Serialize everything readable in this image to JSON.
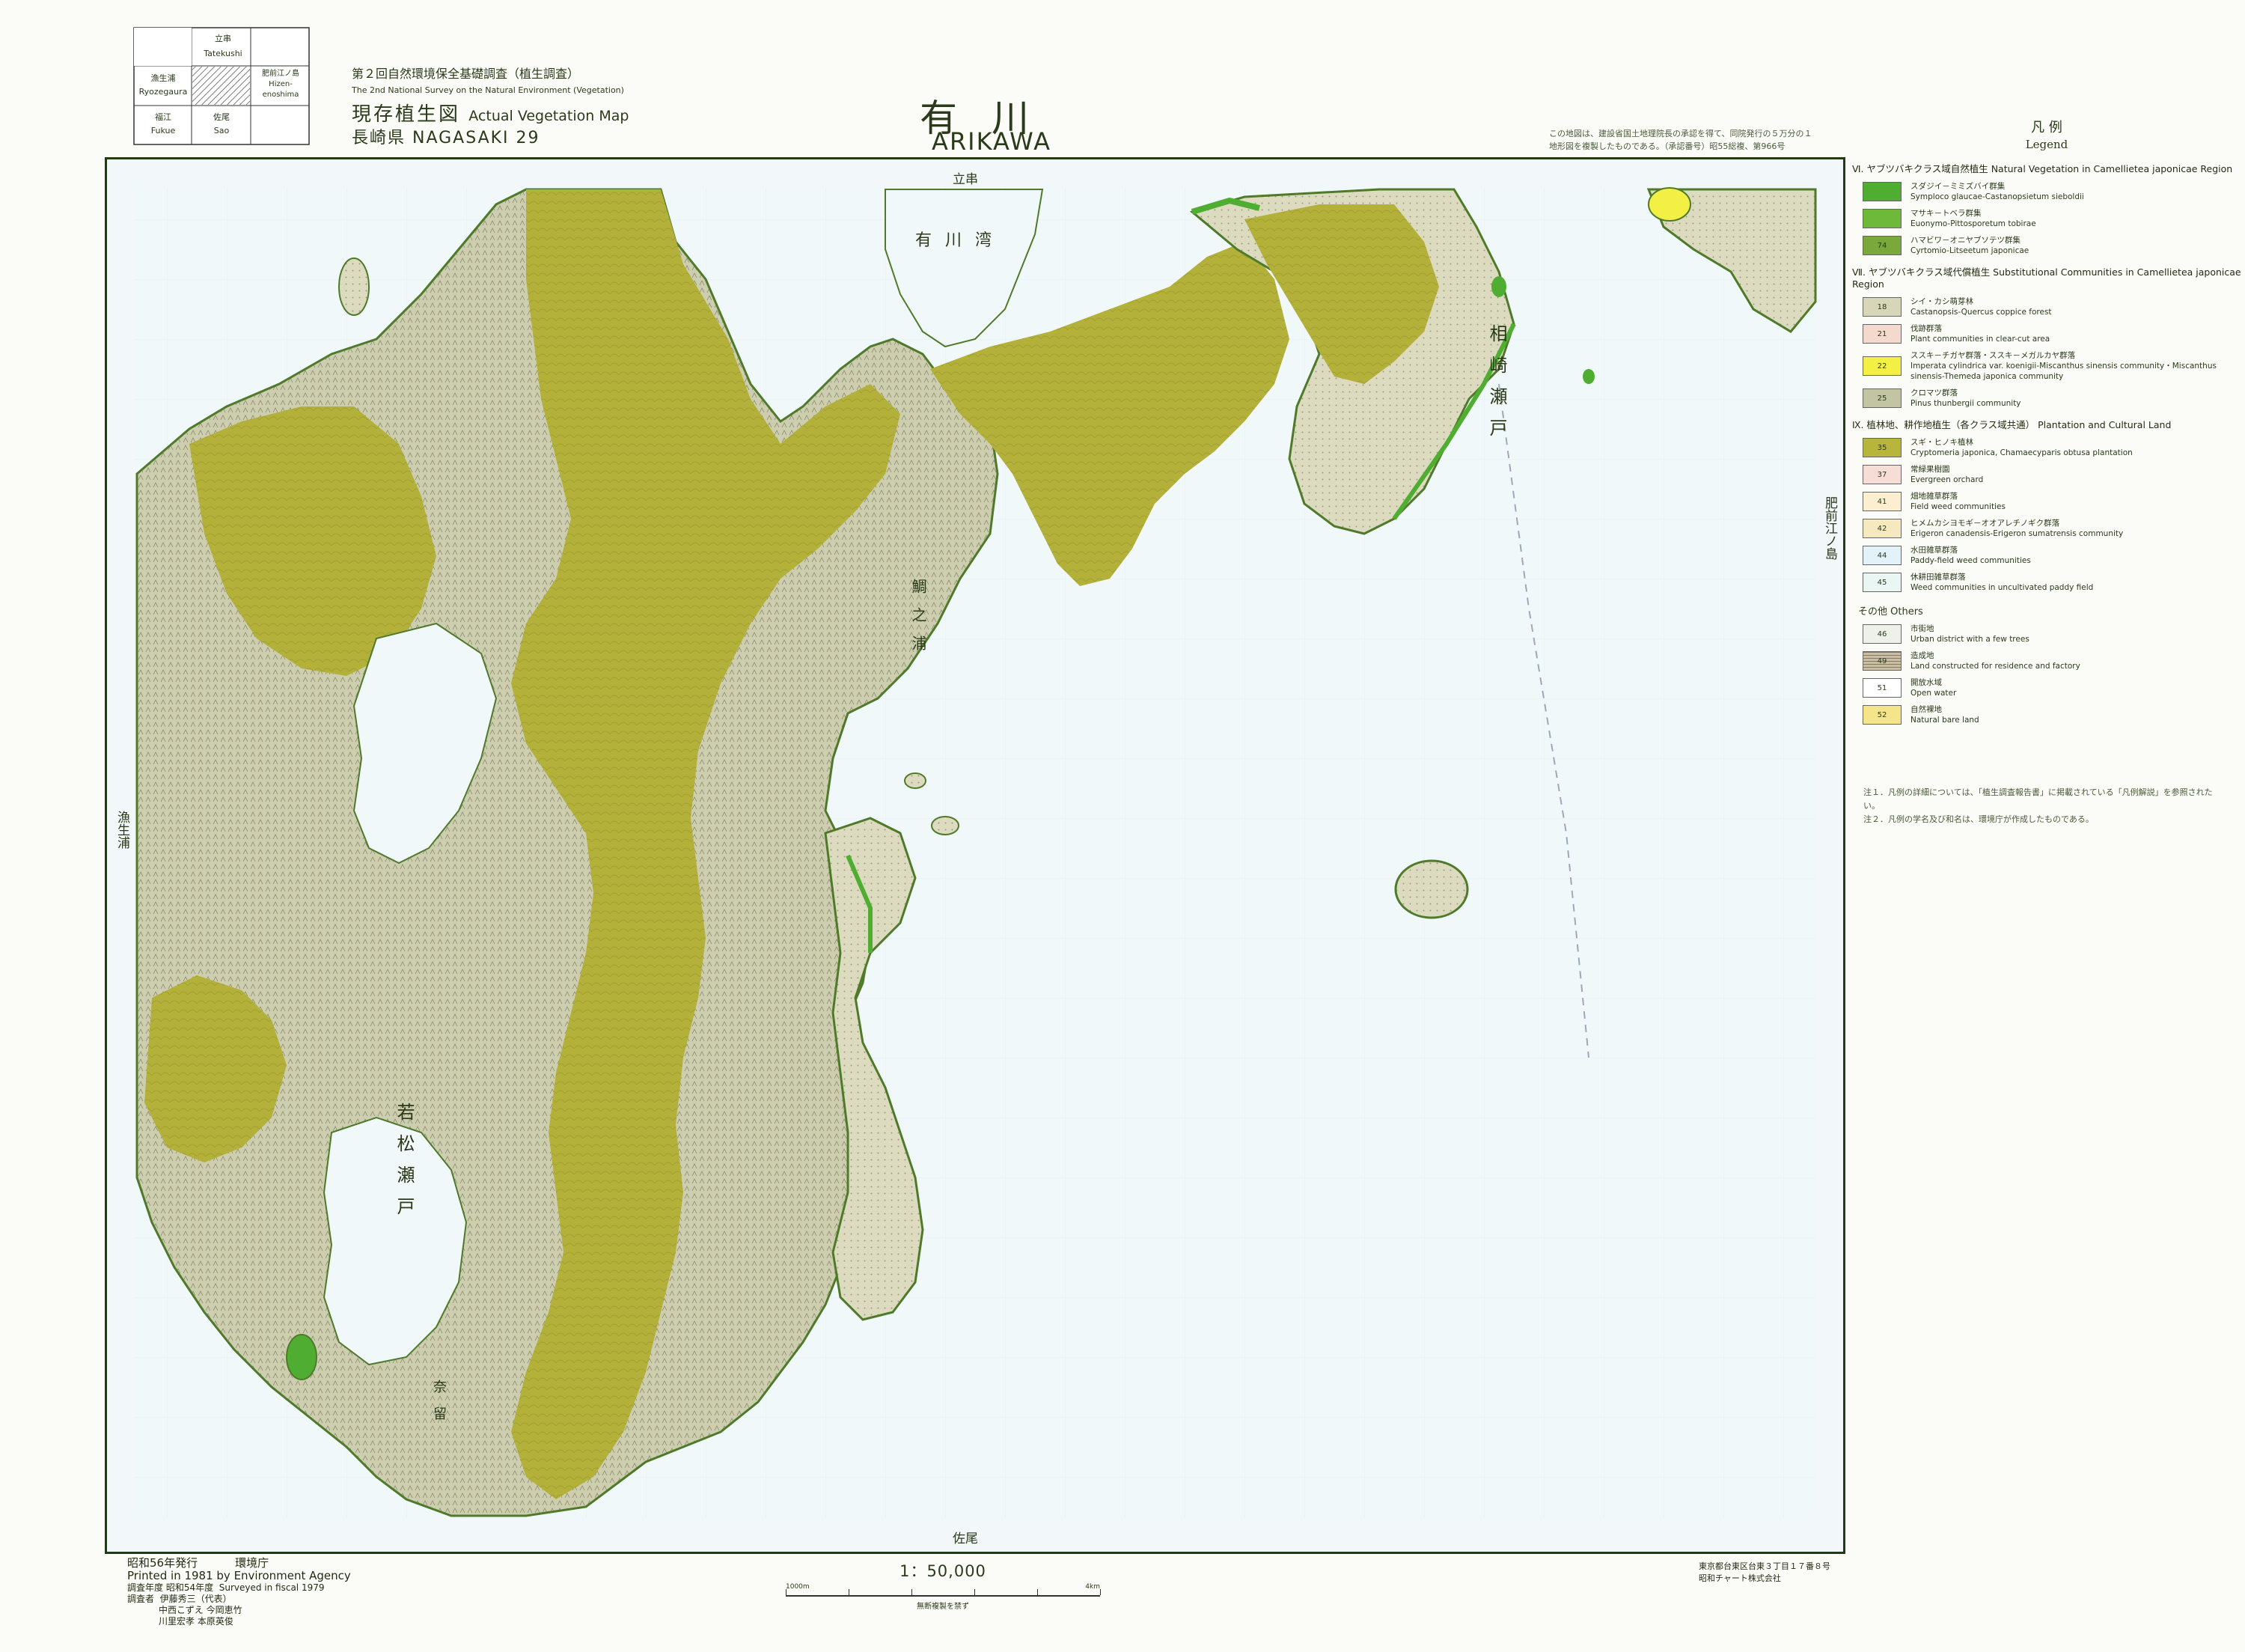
{
  "index_diagram": {
    "cells": [
      {
        "jp": "立串",
        "en": "Tatekushi"
      },
      {
        "jp": "肥前江ノ島",
        "en": "Hizen-enoshima"
      },
      {
        "jp": "漁生浦",
        "en": "Ryozegaura"
      },
      {
        "jp": "福江",
        "en": "Fukue"
      },
      {
        "jp": "佐尾",
        "en": "Sao"
      }
    ]
  },
  "header": {
    "series_jp": "第２回自然環境保全基礎調査（植生調査）",
    "series_en": "The 2nd National Survey on the Natural Environment (Vegetation)",
    "map_type_jp": "現存植生図",
    "map_type_en": "Actual Vegetation Map",
    "prefecture": "長崎県 NAGASAKI 29",
    "title_jp": "有川",
    "title_en": "ARIKAWA",
    "top_note": "この地図は、建設省国土地理院長の承認を得て、同院発行の５万分の１地形図を複製したものである。（承認番号）昭55総複、第966号"
  },
  "map": {
    "top_label": "立串",
    "bottom_label": "佐尾",
    "left_label": "漁生浦",
    "right_label": "肥前江ノ島",
    "places": {
      "arikawa_bay": "有川湾",
      "aizaki_strait": "相崎瀬戸",
      "wakamatsu_strait": "若松瀬戸",
      "tainoura": "鯛之浦",
      "naru": "奈留"
    }
  },
  "legend": {
    "title_jp": "凡 例",
    "title_en": "Legend",
    "sections": [
      {
        "heading": "Ⅵ. ヤブツバキクラス域自然植生 Natural Vegetation in Camellietea japonicae Region",
        "items": [
          {
            "code": "",
            "color": "#4fae32",
            "jp": "スダジイ－ミミズバイ群集",
            "en": "Symploco glaucae-Castanopsietum sieboldii"
          },
          {
            "code": "",
            "color": "#6fb93a",
            "jp": "マサキ－トベラ群集",
            "en": "Euonymo-Pittosporetum tobirae"
          },
          {
            "code": "74",
            "color": "#7aa83a",
            "jp": "ハマビワ－オニヤブソテツ群集",
            "en": "Cyrtomio-Litseetum japonicae"
          }
        ]
      },
      {
        "heading": "Ⅶ. ヤブツバキクラス域代償植生 Substitutional Communities in Camellietea japonicae Region",
        "items": [
          {
            "code": "18",
            "color": "#d7d6b8",
            "jp": "シイ・カシ萌芽林",
            "en": "Castanopsis-Quercus coppice forest"
          },
          {
            "code": "21",
            "color": "#f4d9cf",
            "jp": "伐跡群落",
            "en": "Plant communities in clear-cut area"
          },
          {
            "code": "22",
            "color": "#f3ef45",
            "jp": "ススキ－チガヤ群落・ススキ－メガルカヤ群落",
            "en": "Imperata cylindrica var. koenigii-Miscanthus sinensis community・Miscanthus sinensis-Themeda japonica community"
          },
          {
            "code": "25",
            "color": "#c2c4a4",
            "jp": "クロマツ群落",
            "en": "Pinus thunbergii community"
          }
        ]
      },
      {
        "heading": "Ⅸ. 植林地、耕作地植生（各クラス域共通） Plantation and Cultural Land",
        "items": [
          {
            "code": "35",
            "color": "#b7b63a",
            "jp": "スギ・ヒノキ植林",
            "en": "Cryptomeria japonica, Chamaecyparis obtusa plantation"
          },
          {
            "code": "37",
            "color": "#f6ddd6",
            "jp": "常緑果樹園",
            "en": "Evergreen orchard"
          },
          {
            "code": "41",
            "color": "#fbefcf",
            "jp": "畑地雑草群落",
            "en": "Field weed communities"
          },
          {
            "code": "42",
            "color": "#f7e9bf",
            "jp": "ヒメムカシヨモギ－オオアレチノギク群落",
            "en": "Erigeron canadensis-Erigeron sumatrensis community"
          },
          {
            "code": "44",
            "color": "#e3f2f9",
            "jp": "水田雑草群落",
            "en": "Paddy-field weed communities"
          },
          {
            "code": "45",
            "color": "#e9f6f4",
            "jp": "休耕田雑草群落",
            "en": "Weed communities in uncultivated paddy field"
          }
        ]
      }
    ],
    "others_label": "その他 Others",
    "others": [
      {
        "code": "46",
        "color": "#eef1e9",
        "jp": "市街地",
        "en": "Urban district with a few trees"
      },
      {
        "code": "49",
        "color": "#c9bfa6",
        "jp": "造成地",
        "en": "Land constructed for residence and factory"
      },
      {
        "code": "51",
        "color": "#ffffff",
        "jp": "開放水域",
        "en": "Open water"
      },
      {
        "code": "52",
        "color": "#f5e48a",
        "jp": "自然裸地",
        "en": "Natural bare land"
      }
    ],
    "notes": [
      "注１．凡例の詳細については、「植生調査報告書」に掲載されている「凡例解説」を参照されたい。",
      "注２．凡例の学名及び和名は、環境庁が作成したものである。"
    ]
  },
  "footer": {
    "published_jp": "昭和56年発行",
    "agency_jp": "環境庁",
    "printed_en": "Printed in 1981 by Environment Agency",
    "surveyed_jp": "調査年度 昭和54年度",
    "surveyed_en": "Surveyed in fiscal 1979",
    "surveyors_label": "調査者",
    "surveyors": [
      "伊藤秀三（代表）",
      "中西こずえ 今岡恵竹",
      "川里宏孝 本原英俊"
    ],
    "scale_text": "1：50,000",
    "scale_start": "1000m",
    "scale_end": "4km",
    "reproduction_note": "無断複製を禁ず",
    "printer_lines": [
      "東京都台東区台東３丁目１７番８号",
      "昭和チャート株式会社"
    ]
  }
}
